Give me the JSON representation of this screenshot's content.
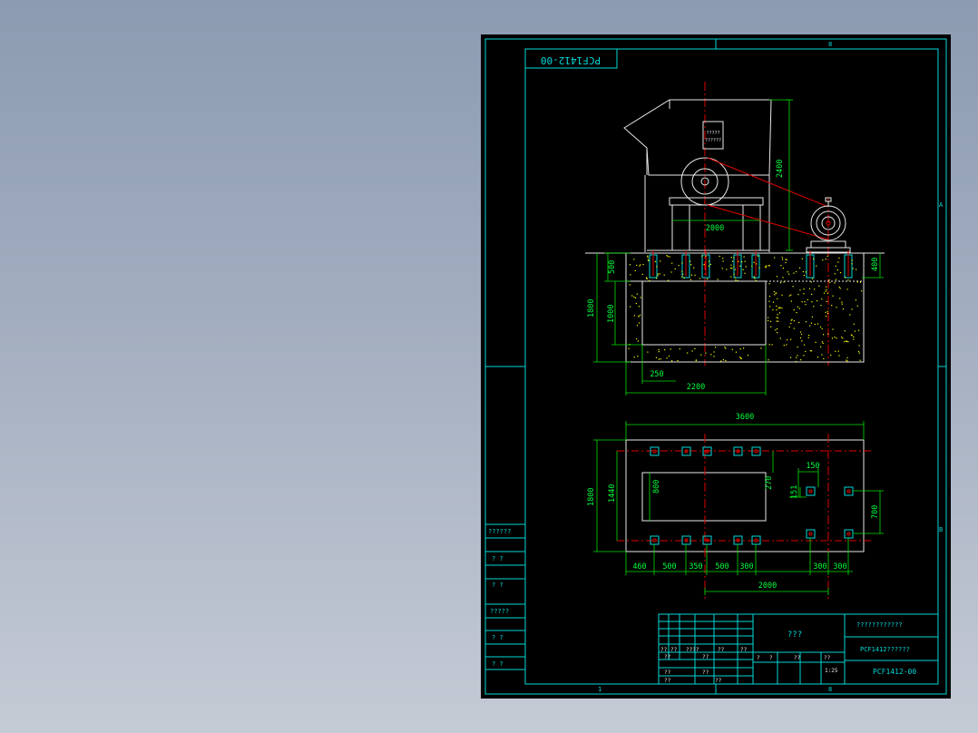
{
  "drawing": {
    "code_top": "PCF1412-00",
    "sheet_zone_top": "8",
    "sheet_zone_bottom_left": "1",
    "sheet_zone_bottom_right": "8",
    "zone_right_a": "A",
    "zone_right_b": "B",
    "nameplate": {
      "line1": "?????",
      "line2": "??????"
    }
  },
  "dimensions": {
    "machine_height": "2400",
    "machine_width": "2000",
    "foundation_upper": "500",
    "foundation_total": "1800",
    "pit_depth": "1000",
    "motor_base": "400",
    "offset": "250",
    "pit_width": "2200",
    "plan_width": "3600",
    "plan_depth": "1800",
    "bolt_span": "1440",
    "pit_plan_depth": "800",
    "offset_270": "270",
    "motor_150": "150",
    "motor_151": "151",
    "motor_700": "700",
    "bottom_row": [
      "460",
      "500",
      "350",
      "500",
      "300",
      "300",
      "300"
    ],
    "plan_2000": "2000"
  },
  "left_strip": [
    "??????",
    "? ?",
    "? ?",
    "?????",
    "? ?",
    "? ?"
  ],
  "title_block": {
    "center_title": "???",
    "company": "????????????",
    "product": "PCF1412??????",
    "drawing_no": "PCF1412-00",
    "scale": "1:25",
    "grid_row1": [
      "??",
      "??",
      "????",
      "??",
      "??"
    ],
    "grid_row2": [
      "??",
      "??"
    ],
    "grid_row3": [
      "??",
      "??"
    ],
    "grid_row4": [
      "??",
      "??"
    ],
    "mid_row": [
      "?",
      "?",
      "??",
      "??"
    ]
  },
  "colors": {
    "frame": "#00d8d8",
    "dimension_text": "#00ff3c",
    "center_line": "#e00000",
    "machine": "#e8e8e8",
    "concrete_dots": "#ffff00"
  }
}
